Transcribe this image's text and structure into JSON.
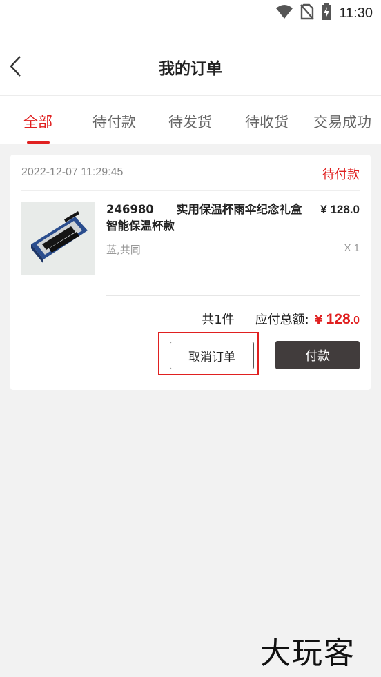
{
  "status_bar": {
    "time": "11:30",
    "icons": [
      "wifi-icon",
      "no-sim-icon",
      "battery-charging-icon"
    ]
  },
  "nav": {
    "back_icon": "chevron-left-icon",
    "title": "我的订单"
  },
  "tabs": [
    {
      "label": "全部",
      "active": true
    },
    {
      "label": "待付款",
      "active": false
    },
    {
      "label": "待发货",
      "active": false
    },
    {
      "label": "待收货",
      "active": false
    },
    {
      "label": "交易成功",
      "active": false
    }
  ],
  "order": {
    "time": "2022-12-07 11:29:45",
    "status": "待付款",
    "item": {
      "name": "246980　　实用保温杯雨伞纪念礼盒 智能保温杯款",
      "price": "¥ 128.0",
      "variant": "蓝,共同",
      "quantity": "X 1"
    },
    "summary": {
      "count": "共1件",
      "total_label": "应付总额:",
      "currency": "¥",
      "total_int": "128",
      "total_dec": ".0"
    },
    "actions": {
      "cancel_label": "取消订单",
      "pay_label": "付款"
    }
  },
  "watermark": "大玩客",
  "colors": {
    "accent": "#e02020",
    "pay_button": "#413c3c",
    "background": "#f2f2f2"
  }
}
